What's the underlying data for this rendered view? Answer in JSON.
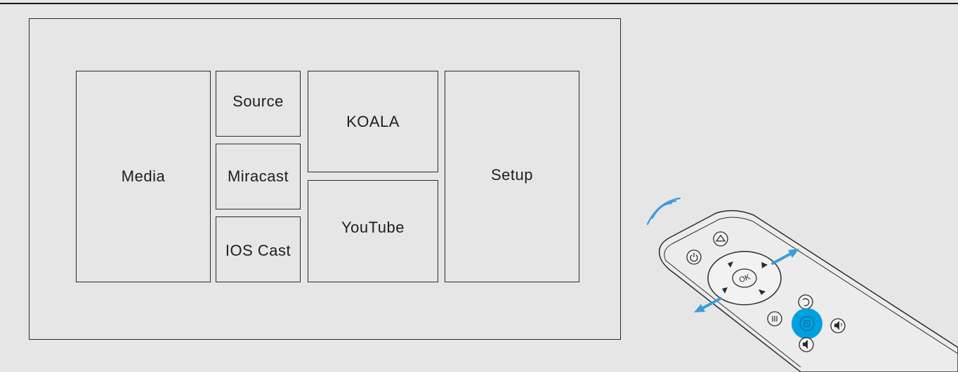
{
  "menu": {
    "media": "Media",
    "source": "Source",
    "miracast": "Miracast",
    "ios_cast": "IOS Cast",
    "koala": "KOALA",
    "youtube": "YouTube",
    "setup": "Setup"
  },
  "remote": {
    "ok_label": "OK",
    "highlight_color": "#00a0e0",
    "arrow_color": "#3d9bd9",
    "buttons": [
      "power-icon",
      "home-icon",
      "back-icon",
      "menu-icon",
      "volume-down-icon",
      "volume-up-icon",
      "mouse-icon"
    ]
  }
}
